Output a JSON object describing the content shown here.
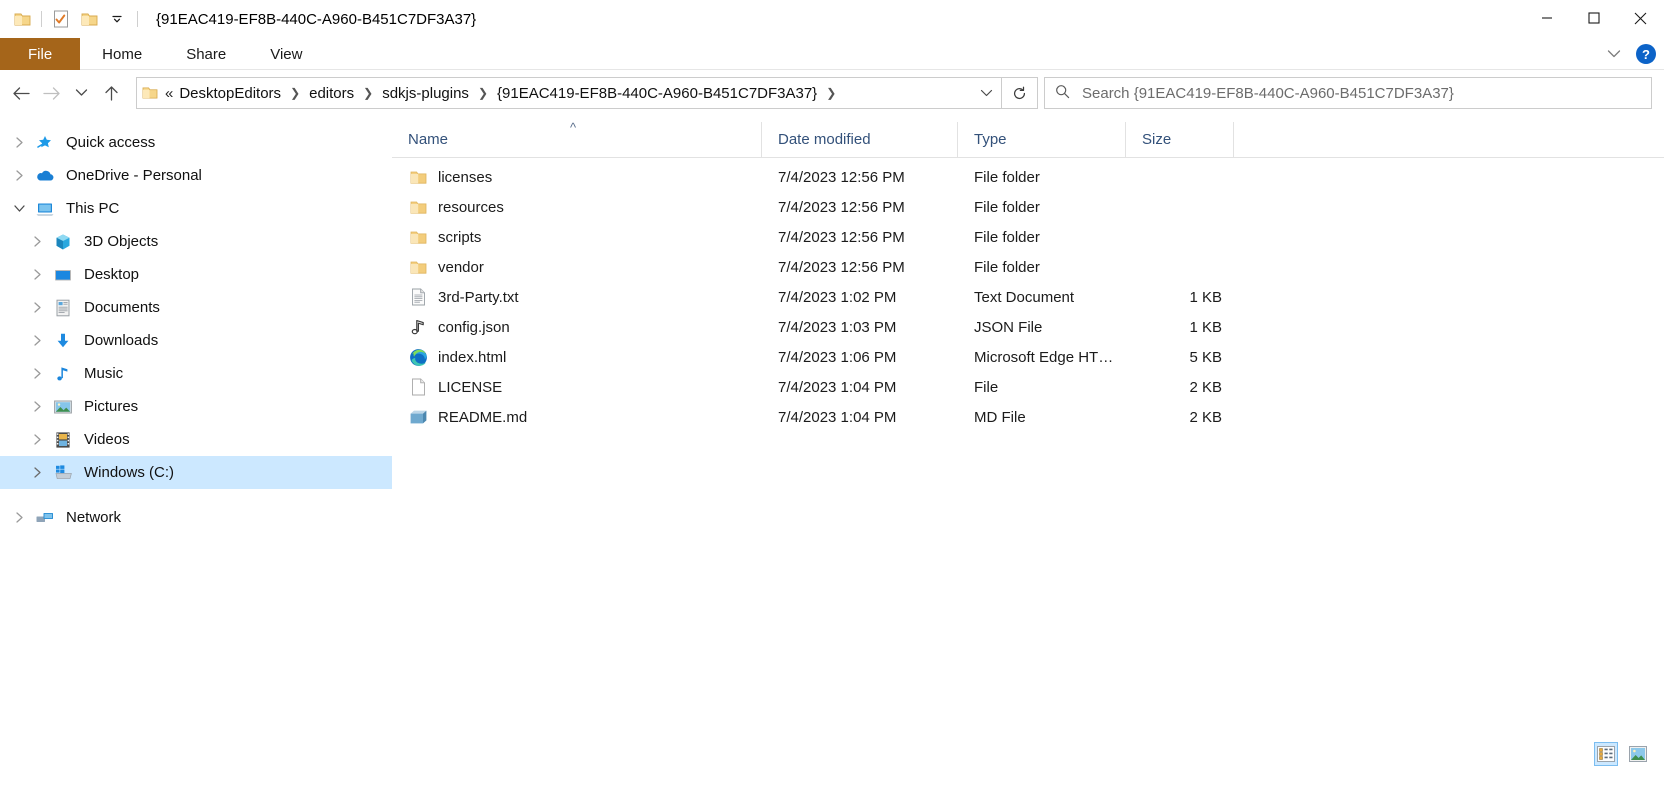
{
  "window": {
    "title": "{91EAC419-EF8B-440C-A960-B451C7DF3A37}",
    "minimize_label": "Minimize",
    "maximize_label": "Maximize",
    "close_label": "Close"
  },
  "quick_access_toolbar": {
    "folder_label": "Customize Quick Access Toolbar",
    "properties_label": "Properties",
    "new_folder_label": "New folder",
    "dropdown_label": "Customize"
  },
  "ribbon": {
    "tabs": [
      {
        "label": "File",
        "active": true
      },
      {
        "label": "Home",
        "active": false
      },
      {
        "label": "Share",
        "active": false
      },
      {
        "label": "View",
        "active": false
      }
    ],
    "collapse_label": "Minimize the Ribbon",
    "help_label": "?"
  },
  "navigation": {
    "back_label": "Back",
    "forward_label": "Forward",
    "recent_label": "Recent locations",
    "up_label": "Up"
  },
  "address": {
    "overflow": "«",
    "crumbs": [
      "DesktopEditors",
      "editors",
      "sdkjs-plugins",
      "{91EAC419-EF8B-440C-A960-B451C7DF3A37}"
    ],
    "dropdown_label": "Previous locations",
    "refresh_label": "Refresh"
  },
  "search": {
    "placeholder": "Search {91EAC419-EF8B-440C-A960-B451C7DF3A37}",
    "value": ""
  },
  "sidebar": {
    "items": [
      {
        "label": "Quick access",
        "icon": "star-pin-icon",
        "level": 1,
        "expanded": false,
        "selected": false
      },
      {
        "label": "OneDrive - Personal",
        "icon": "cloud-icon",
        "level": 1,
        "expanded": false,
        "selected": false
      },
      {
        "label": "This PC",
        "icon": "computer-icon",
        "level": 1,
        "expanded": true,
        "selected": false
      },
      {
        "label": "3D Objects",
        "icon": "cube-icon",
        "level": 2,
        "expanded": false,
        "selected": false
      },
      {
        "label": "Desktop",
        "icon": "desktop-icon",
        "level": 2,
        "expanded": false,
        "selected": false
      },
      {
        "label": "Documents",
        "icon": "documents-icon",
        "level": 2,
        "expanded": false,
        "selected": false
      },
      {
        "label": "Downloads",
        "icon": "download-arrow-icon",
        "level": 2,
        "expanded": false,
        "selected": false
      },
      {
        "label": "Music",
        "icon": "music-note-icon",
        "level": 2,
        "expanded": false,
        "selected": false
      },
      {
        "label": "Pictures",
        "icon": "picture-icon",
        "level": 2,
        "expanded": false,
        "selected": false
      },
      {
        "label": "Videos",
        "icon": "video-film-icon",
        "level": 2,
        "expanded": false,
        "selected": false
      },
      {
        "label": "Windows (C:)",
        "icon": "hard-drive-icon",
        "level": 2,
        "expanded": false,
        "selected": true
      },
      {
        "label": "Network",
        "icon": "network-icon",
        "level": 1,
        "expanded": false,
        "selected": false
      }
    ]
  },
  "filelist": {
    "columns": [
      {
        "label": "Name",
        "sort": "asc"
      },
      {
        "label": "Date modified",
        "sort": ""
      },
      {
        "label": "Type",
        "sort": ""
      },
      {
        "label": "Size",
        "sort": ""
      }
    ],
    "rows": [
      {
        "name": "licenses",
        "date": "7/4/2023 12:56 PM",
        "type": "File folder",
        "size": "",
        "icon": "folder-icon"
      },
      {
        "name": "resources",
        "date": "7/4/2023 12:56 PM",
        "type": "File folder",
        "size": "",
        "icon": "folder-icon"
      },
      {
        "name": "scripts",
        "date": "7/4/2023 12:56 PM",
        "type": "File folder",
        "size": "",
        "icon": "folder-icon"
      },
      {
        "name": "vendor",
        "date": "7/4/2023 12:56 PM",
        "type": "File folder",
        "size": "",
        "icon": "folder-icon"
      },
      {
        "name": "3rd-Party.txt",
        "date": "7/4/2023 1:02 PM",
        "type": "Text Document",
        "size": "1 KB",
        "icon": "text-file-icon"
      },
      {
        "name": "config.json",
        "date": "7/4/2023 1:03 PM",
        "type": "JSON File",
        "size": "1 KB",
        "icon": "json-file-icon"
      },
      {
        "name": "index.html",
        "date": "7/4/2023 1:06 PM",
        "type": "Microsoft Edge HT…",
        "size": "5 KB",
        "icon": "edge-browser-icon"
      },
      {
        "name": "LICENSE",
        "date": "7/4/2023 1:04 PM",
        "type": "File",
        "size": "2 KB",
        "icon": "blank-file-icon"
      },
      {
        "name": "README.md",
        "date": "7/4/2023 1:04 PM",
        "type": "MD File",
        "size": "2 KB",
        "icon": "md-file-icon"
      }
    ]
  },
  "view_buttons": {
    "details_label": "Details view",
    "large_icons_label": "Large icons view",
    "active": "details"
  },
  "colors": {
    "file_tab": "#a5651a",
    "selection": "#cce8ff",
    "help_button": "#0c63c8",
    "folder": "#ffd47f",
    "column_header_text": "#33517a"
  }
}
